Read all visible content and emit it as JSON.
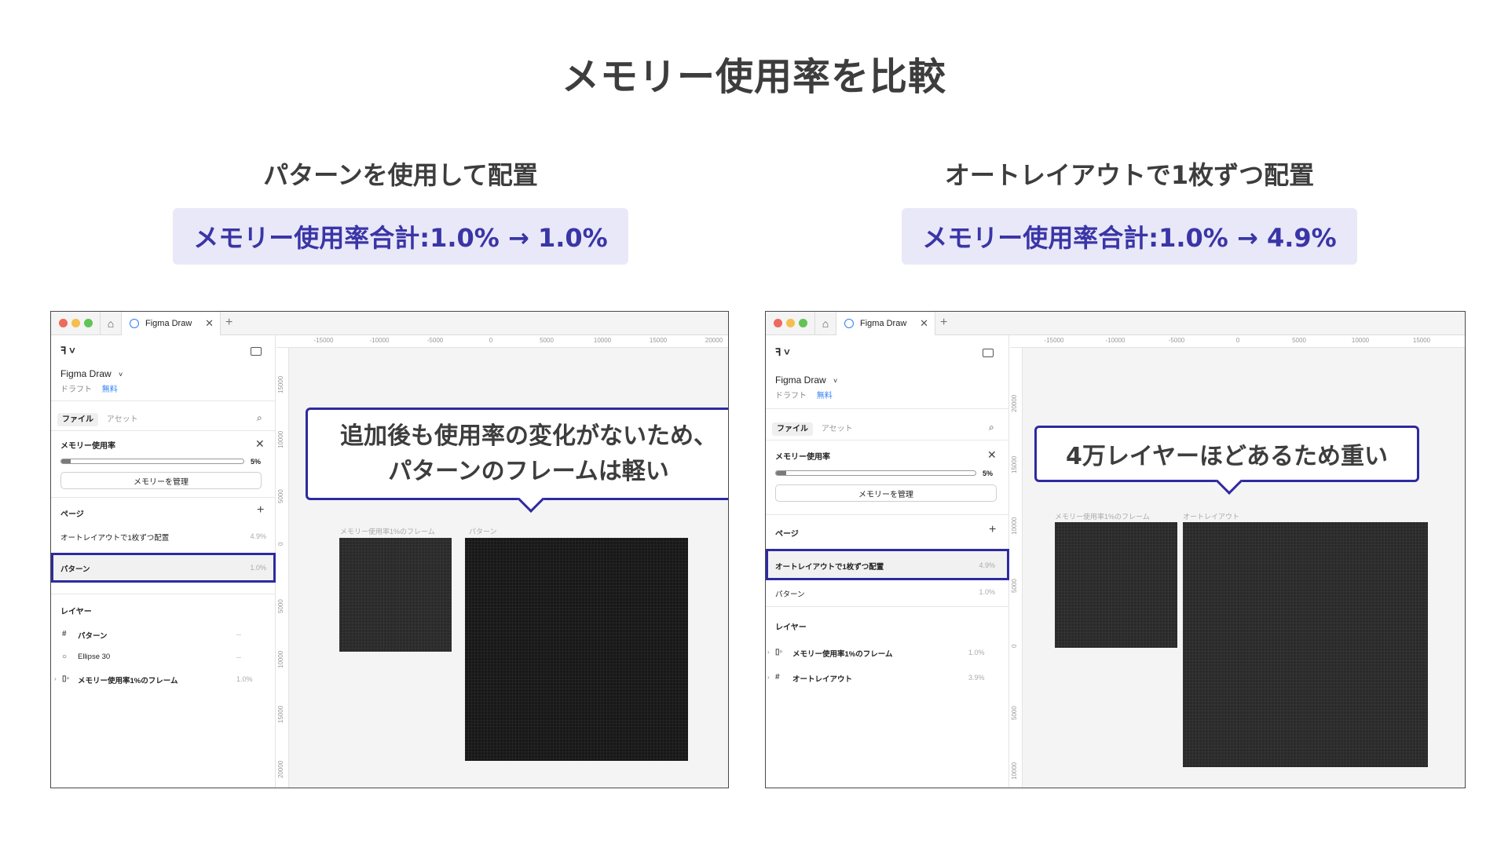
{
  "title": "メモリー使用率を比較",
  "left": {
    "heading": "パターンを使用して配置",
    "summary": "メモリー使用率合計:1.0% → 1.0%",
    "callout_lines": [
      "追加後も使用率の変化がないため、",
      "パターンのフレームは軽い"
    ],
    "window": {
      "tab_title": "Figma Draw",
      "project": "Figma Draw",
      "draft": "ドラフト",
      "plan": "無料",
      "file_tab": "ファイル",
      "asset_tab": "アセット",
      "memory_label": "メモリー使用率",
      "memory_pct": "5%",
      "memory_fraction": 0.05,
      "manage_button": "メモリーを管理",
      "pages_title": "ページ",
      "pages": [
        {
          "name": "オートレイアウトで1枚ずつ配置",
          "value": "4.9%"
        },
        {
          "name": "パターン",
          "value": "1.0%"
        }
      ],
      "layers_title": "レイヤー",
      "layers": [
        {
          "icon": "#",
          "name": "パターン",
          "value": "--"
        },
        {
          "icon": "○",
          "name": "Ellipse 30",
          "value": "--"
        },
        {
          "icon": "▯▫",
          "name": "メモリー使用率1%のフレーム",
          "value": "1.0%"
        }
      ],
      "ruler_top": [
        "-15000",
        "-10000",
        "-5000",
        "0",
        "5000",
        "10000",
        "15000",
        "20000"
      ],
      "ruler_left": [
        "15000",
        "10000",
        "5000",
        "0",
        "5000",
        "10000",
        "15000",
        "20000"
      ],
      "frame_labels": [
        "メモリー使用率1%のフレーム",
        "パターン"
      ]
    }
  },
  "right": {
    "heading": "オートレイアウトで1枚ずつ配置",
    "summary": "メモリー使用率合計:1.0% → 4.9%",
    "callout_lines": [
      "4万レイヤーほどあるため重い"
    ],
    "window": {
      "tab_title": "Figma Draw",
      "project": "Figma Draw",
      "draft": "ドラフト",
      "plan": "無料",
      "file_tab": "ファイル",
      "asset_tab": "アセット",
      "memory_label": "メモリー使用率",
      "memory_pct": "5%",
      "memory_fraction": 0.05,
      "manage_button": "メモリーを管理",
      "pages_title": "ページ",
      "pages": [
        {
          "name": "オートレイアウトで1枚ずつ配置",
          "value": "4.9%"
        },
        {
          "name": "パターン",
          "value": "1.0%"
        }
      ],
      "layers_title": "レイヤー",
      "layers": [
        {
          "icon": "▯▫",
          "name": "メモリー使用率1%のフレーム",
          "value": "1.0%"
        },
        {
          "icon": "#",
          "name": "オートレイアウト",
          "value": "3.9%"
        }
      ],
      "ruler_top": [
        "-15000",
        "-10000",
        "-5000",
        "0",
        "5000",
        "10000",
        "15000"
      ],
      "ruler_left": [
        "20000",
        "15000",
        "10000",
        "5000",
        "0",
        "5000",
        "10000"
      ],
      "frame_labels": [
        "メモリー使用率1%のフレーム",
        "オートレイアウト"
      ]
    }
  },
  "colors": {
    "accent": "#2f2aa0",
    "pill_bg": "#e9e8f8",
    "pill_text": "#3a35a6"
  }
}
